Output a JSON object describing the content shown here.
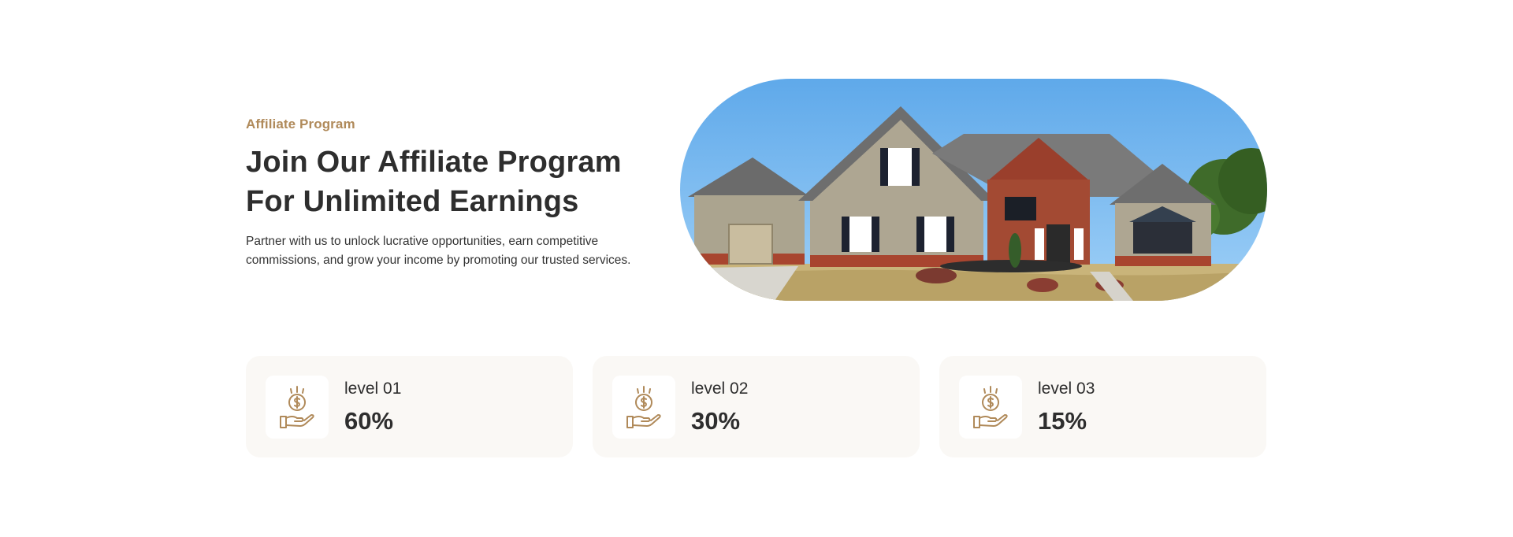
{
  "hero": {
    "eyebrow": "Affiliate Program",
    "headline_line1": "Join Our Affiliate Program",
    "headline_line2": "For Unlimited Earnings",
    "description_line1": "Partner with us to unlock lucrative opportunities, earn competitive",
    "description_line2": "commissions, and grow your income by promoting our trusted services.",
    "image_icon": "house-photo"
  },
  "cards": [
    {
      "level": "level 01",
      "percent": "60%",
      "icon": "hand-coin-icon"
    },
    {
      "level": "level 02",
      "percent": "30%",
      "icon": "hand-coin-icon"
    },
    {
      "level": "level 03",
      "percent": "15%",
      "icon": "hand-coin-icon"
    }
  ],
  "colors": {
    "accent": "#b08a5a",
    "text": "#2e2e2e",
    "card_bg": "#faf8f5",
    "sky": "#6cb3ee"
  }
}
